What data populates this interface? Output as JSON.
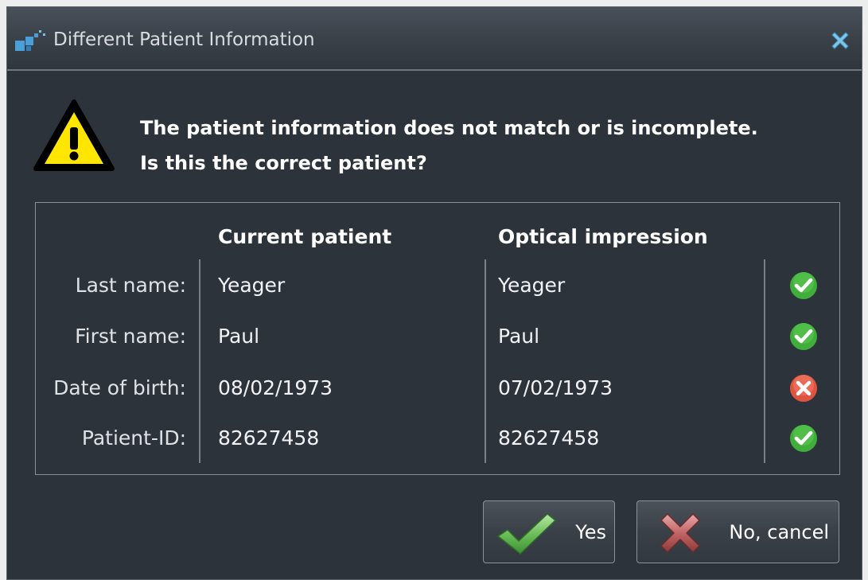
{
  "window": {
    "title": "Different Patient Information",
    "app_icon": "app-logo-icon",
    "close_icon": "close-icon"
  },
  "message": {
    "icon": "warning-icon",
    "line1": "The patient information does not match or is incomplete.",
    "line2": "Is this the correct patient?"
  },
  "table": {
    "headers": {
      "current": "Current patient",
      "optical": "Optical impression"
    },
    "rows": [
      {
        "label": "Last name:",
        "current": "Yeager",
        "optical": "Yeager",
        "status": "match",
        "status_icon": "check-icon"
      },
      {
        "label": "First name:",
        "current": "Paul",
        "optical": "Paul",
        "status": "match",
        "status_icon": "check-icon"
      },
      {
        "label": "Date of birth:",
        "current": "08/02/1973",
        "optical": "07/02/1973",
        "status": "mismatch",
        "status_icon": "error-icon"
      },
      {
        "label": "Patient-ID:",
        "current": "82627458",
        "optical": "82627458",
        "status": "match",
        "status_icon": "check-icon"
      }
    ]
  },
  "buttons": {
    "yes": {
      "label": "Yes",
      "icon": "checkmark-icon"
    },
    "cancel": {
      "label": "No, cancel",
      "icon": "cross-icon"
    }
  },
  "colors": {
    "background": "#2d333b",
    "match": "#3fae3a",
    "mismatch": "#e0533f",
    "warning": "#ffe600"
  }
}
